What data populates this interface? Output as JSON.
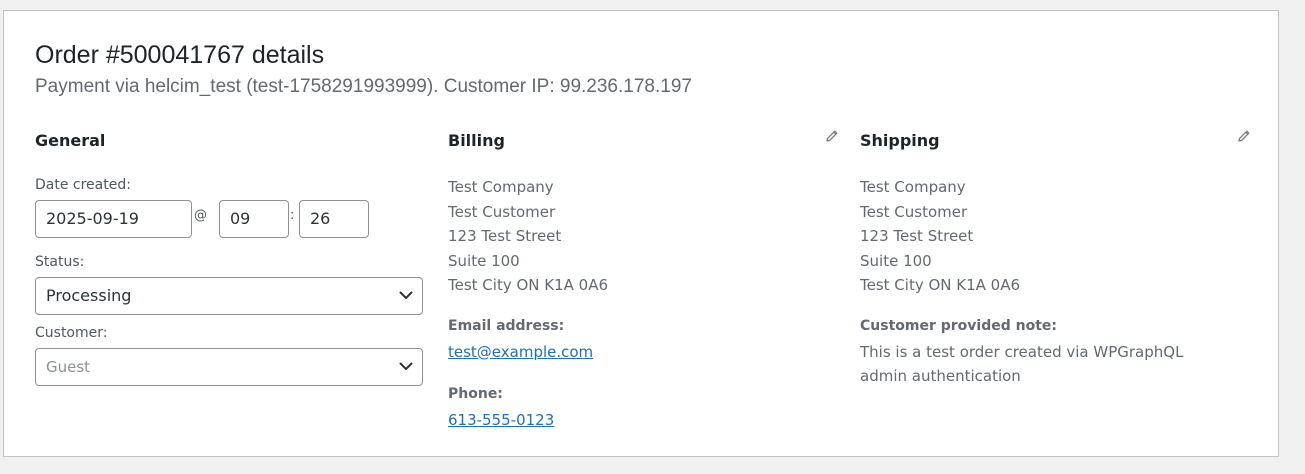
{
  "order": {
    "title": "Order #500041767 details",
    "subtitle": "Payment via helcim_test (test-1758291993999). Customer IP: 99.236.178.197"
  },
  "general": {
    "heading": "General",
    "date_label": "Date created:",
    "date": "2025-09-19",
    "at": "@",
    "hour": "09",
    "colon": ":",
    "minute": "26",
    "status_label": "Status:",
    "status": "Processing",
    "customer_label": "Customer:",
    "customer": "Guest"
  },
  "billing": {
    "heading": "Billing",
    "address": [
      "Test Company",
      "Test Customer",
      "123 Test Street",
      "Suite 100",
      "Test City ON K1A 0A6"
    ],
    "email_label": "Email address:",
    "email": "test@example.com",
    "phone_label": "Phone:",
    "phone": "613-555-0123"
  },
  "shipping": {
    "heading": "Shipping",
    "address": [
      "Test Company",
      "Test Customer",
      "123 Test Street",
      "Suite 100",
      "Test City ON K1A 0A6"
    ],
    "note_label": "Customer provided note:",
    "note": "This is a test order created via WPGraphQL\nadmin authentication"
  },
  "icons": {
    "billing_edit": "pencil-icon",
    "shipping_edit": "pencil-icon",
    "select_arrow": "chevron-down-icon"
  },
  "colors": {
    "link": "#2271b1",
    "panel_border": "#c3c4c7",
    "background": "#f0f0f1"
  }
}
